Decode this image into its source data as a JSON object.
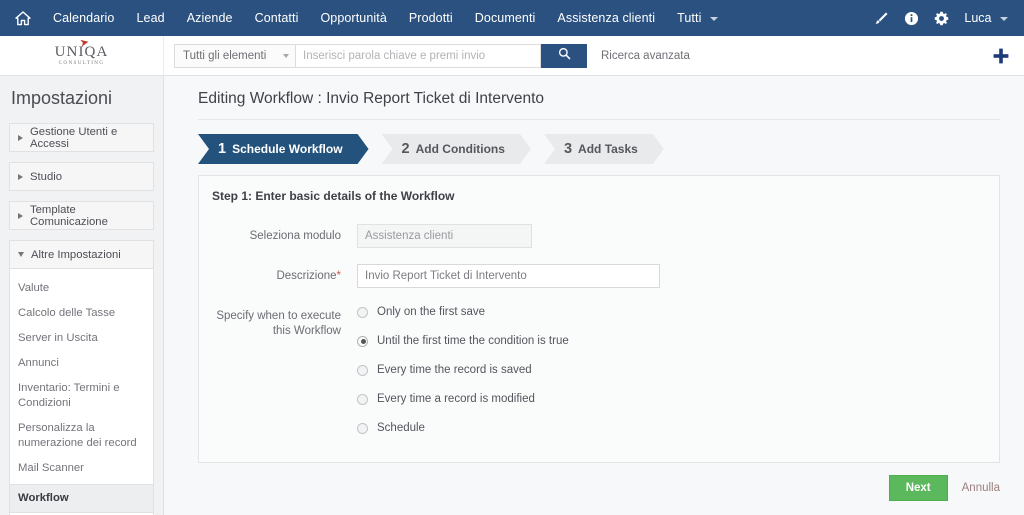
{
  "topnav": {
    "home_icon": "home-icon",
    "items": [
      {
        "label": "Calendario"
      },
      {
        "label": "Lead"
      },
      {
        "label": "Aziende"
      },
      {
        "label": "Contatti"
      },
      {
        "label": "Opportunità"
      },
      {
        "label": "Prodotti"
      },
      {
        "label": "Documenti"
      },
      {
        "label": "Assistenza clienti"
      },
      {
        "label": "Tutti",
        "has_caret": true
      }
    ],
    "right_icons": [
      "brush-icon",
      "info-icon",
      "gear-icon"
    ],
    "username": "Luca"
  },
  "searchbar": {
    "logo_main": "UNIQA",
    "logo_sub": "CONSULTING",
    "module_select": "Tutti gli elementi",
    "placeholder": "Inserisci parola chiave e premi invio",
    "search_value": "",
    "search_button_icon": "search-icon",
    "advanced_search": "Ricerca avanzata",
    "plus_icon": "plus-icon"
  },
  "sidebar": {
    "title": "Impostazioni",
    "groups": [
      {
        "label": "Gestione Utenti e Accessi",
        "open": false
      },
      {
        "label": "Studio",
        "open": false
      },
      {
        "label": "Template Comunicazione",
        "open": false
      },
      {
        "label": "Altre Impostazioni",
        "open": true
      }
    ],
    "sub_items": [
      {
        "label": "Valute",
        "active": false
      },
      {
        "label": "Calcolo delle Tasse",
        "active": false
      },
      {
        "label": "Server in Uscita",
        "active": false
      },
      {
        "label": "Annunci",
        "active": false
      },
      {
        "label": "Inventario: Termini e Condizioni",
        "active": false
      },
      {
        "label": "Personalizza la numerazione dei record",
        "active": false
      },
      {
        "label": "Mail Scanner",
        "active": false
      },
      {
        "label": "Workflow",
        "active": true
      }
    ]
  },
  "main": {
    "page_title": "Editing Workflow : Invio Report Ticket di Intervento",
    "steps": [
      {
        "num": "1",
        "label": "Schedule Workflow",
        "active": true
      },
      {
        "num": "2",
        "label": "Add Conditions",
        "active": false
      },
      {
        "num": "3",
        "label": "Add Tasks",
        "active": false
      }
    ],
    "panel": {
      "step_title": "Step 1: Enter basic details of the Workflow",
      "module_label": "Seleziona modulo",
      "module_value": "Assistenza clienti",
      "description_label": "Descrizione",
      "description_required": "*",
      "description_value": "Invio Report Ticket di Intervento",
      "execute_label_line1": "Specify when to execute",
      "execute_label_line2": "this Workflow",
      "options": [
        {
          "label": "Only on the first save",
          "selected": false
        },
        {
          "label": "Until the first time the condition is true",
          "selected": true
        },
        {
          "label": "Every time the record is saved",
          "selected": false
        },
        {
          "label": "Every time a record is modified",
          "selected": false
        },
        {
          "label": "Schedule",
          "selected": false
        }
      ]
    },
    "footer": {
      "next_label": "Next",
      "cancel_label": "Annulla"
    }
  },
  "colors": {
    "navbar_blue": "#2b5181",
    "step_active_blue": "#23527c",
    "next_green": "#5cb85c",
    "required_red": "#d9534f",
    "logo_accent_red": "#c0392b"
  }
}
